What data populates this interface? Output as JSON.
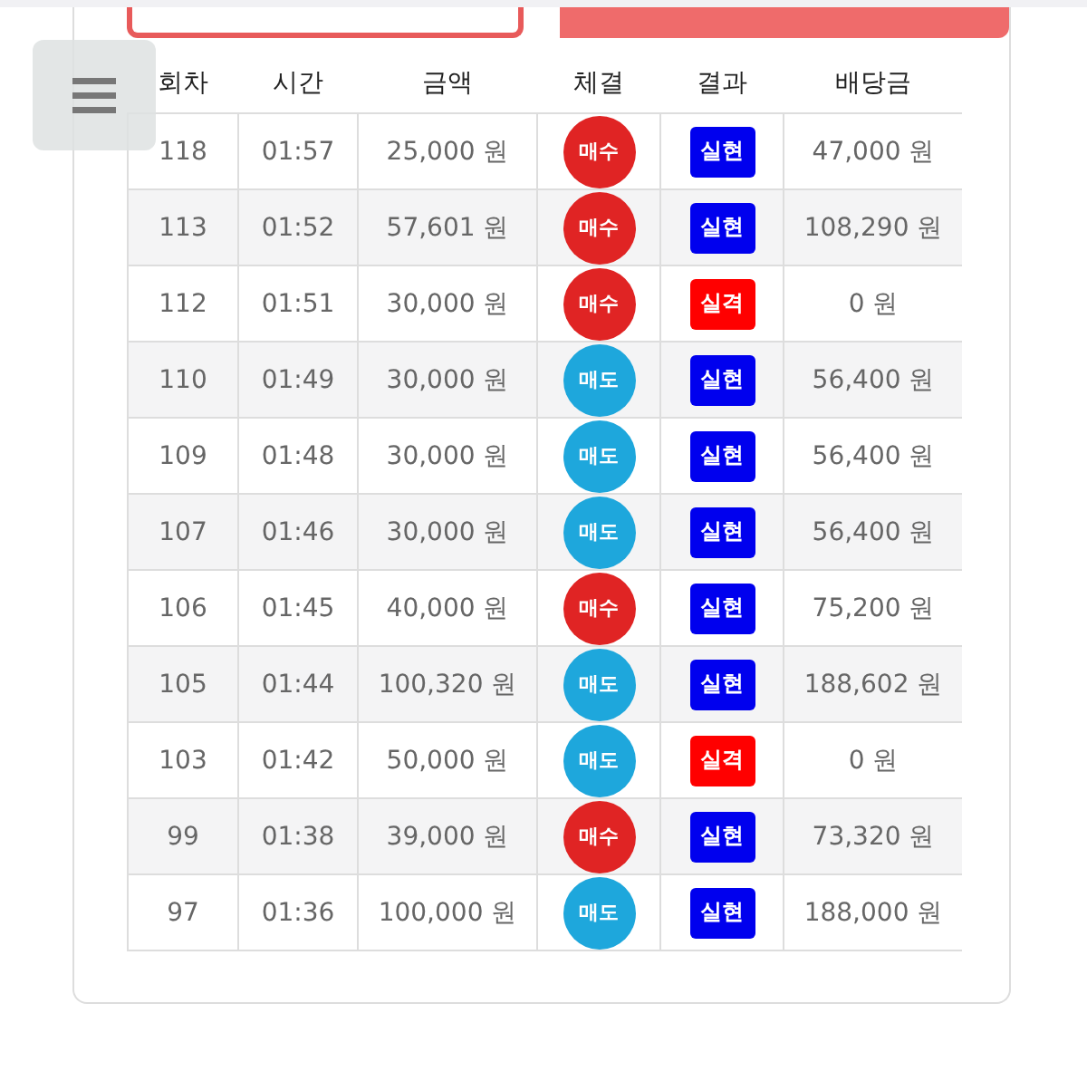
{
  "table": {
    "columns": [
      "회차",
      "시간",
      "금액",
      "체결",
      "결과",
      "배당금"
    ],
    "rows": [
      {
        "round": "118",
        "time": "01:57",
        "amount": "25,000 원",
        "trade": {
          "label": "매수",
          "color": "#e02424"
        },
        "result": {
          "label": "실현",
          "color": "#0000ee"
        },
        "payout": "47,000 원"
      },
      {
        "round": "113",
        "time": "01:52",
        "amount": "57,601 원",
        "trade": {
          "label": "매수",
          "color": "#e02424"
        },
        "result": {
          "label": "실현",
          "color": "#0000ee"
        },
        "payout": "108,290 원"
      },
      {
        "round": "112",
        "time": "01:51",
        "amount": "30,000 원",
        "trade": {
          "label": "매수",
          "color": "#e02424"
        },
        "result": {
          "label": "실격",
          "color": "#ff0000"
        },
        "payout": "0 원"
      },
      {
        "round": "110",
        "time": "01:49",
        "amount": "30,000 원",
        "trade": {
          "label": "매도",
          "color": "#1ea7dc"
        },
        "result": {
          "label": "실현",
          "color": "#0000ee"
        },
        "payout": "56,400 원"
      },
      {
        "round": "109",
        "time": "01:48",
        "amount": "30,000 원",
        "trade": {
          "label": "매도",
          "color": "#1ea7dc"
        },
        "result": {
          "label": "실현",
          "color": "#0000ee"
        },
        "payout": "56,400 원"
      },
      {
        "round": "107",
        "time": "01:46",
        "amount": "30,000 원",
        "trade": {
          "label": "매도",
          "color": "#1ea7dc"
        },
        "result": {
          "label": "실현",
          "color": "#0000ee"
        },
        "payout": "56,400 원"
      },
      {
        "round": "106",
        "time": "01:45",
        "amount": "40,000 원",
        "trade": {
          "label": "매수",
          "color": "#e02424"
        },
        "result": {
          "label": "실현",
          "color": "#0000ee"
        },
        "payout": "75,200 원"
      },
      {
        "round": "105",
        "time": "01:44",
        "amount": "100,320 원",
        "trade": {
          "label": "매도",
          "color": "#1ea7dc"
        },
        "result": {
          "label": "실현",
          "color": "#0000ee"
        },
        "payout": "188,602 원"
      },
      {
        "round": "103",
        "time": "01:42",
        "amount": "50,000 원",
        "trade": {
          "label": "매도",
          "color": "#1ea7dc"
        },
        "result": {
          "label": "실격",
          "color": "#ff0000"
        },
        "payout": "0 원"
      },
      {
        "round": "99",
        "time": "01:38",
        "amount": "39,000 원",
        "trade": {
          "label": "매수",
          "color": "#e02424"
        },
        "result": {
          "label": "실현",
          "color": "#0000ee"
        },
        "payout": "73,320 원"
      },
      {
        "round": "97",
        "time": "01:36",
        "amount": "100,000 원",
        "trade": {
          "label": "매도",
          "color": "#1ea7dc"
        },
        "result": {
          "label": "실현",
          "color": "#0000ee"
        },
        "payout": "188,000 원"
      }
    ]
  }
}
